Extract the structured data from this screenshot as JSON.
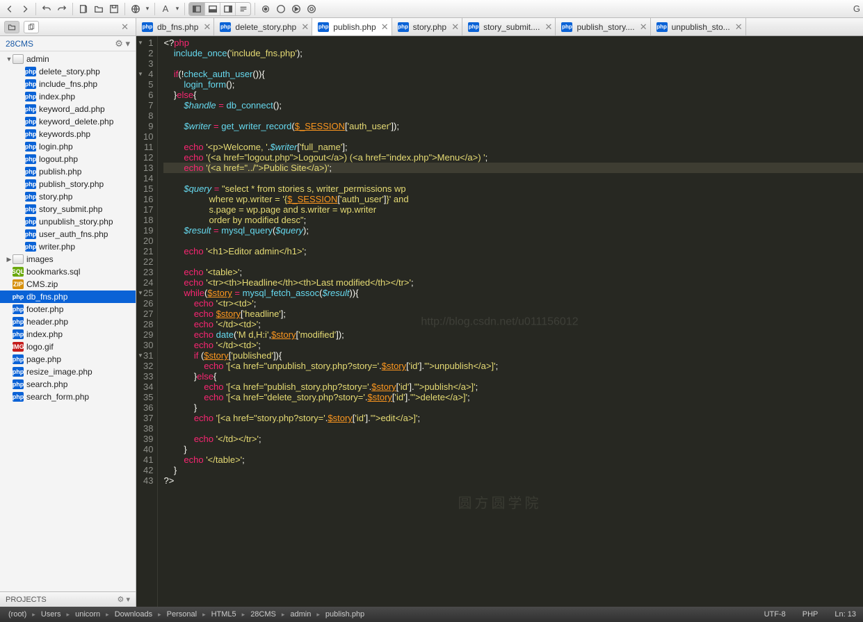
{
  "toolbar": {
    "sync_dropdown": "▾"
  },
  "sidebar": {
    "project_name": "28CMS",
    "footer_label": "PROJECTS",
    "tree": [
      {
        "name": "admin",
        "type": "folder",
        "depth": 0,
        "expanded": true
      },
      {
        "name": "delete_story.php",
        "type": "php",
        "depth": 1
      },
      {
        "name": "include_fns.php",
        "type": "php",
        "depth": 1
      },
      {
        "name": "index.php",
        "type": "php",
        "depth": 1
      },
      {
        "name": "keyword_add.php",
        "type": "php",
        "depth": 1
      },
      {
        "name": "keyword_delete.php",
        "type": "php",
        "depth": 1
      },
      {
        "name": "keywords.php",
        "type": "php",
        "depth": 1
      },
      {
        "name": "login.php",
        "type": "php",
        "depth": 1
      },
      {
        "name": "logout.php",
        "type": "php",
        "depth": 1
      },
      {
        "name": "publish.php",
        "type": "php",
        "depth": 1
      },
      {
        "name": "publish_story.php",
        "type": "php",
        "depth": 1
      },
      {
        "name": "story.php",
        "type": "php",
        "depth": 1
      },
      {
        "name": "story_submit.php",
        "type": "php",
        "depth": 1
      },
      {
        "name": "unpublish_story.php",
        "type": "php",
        "depth": 1
      },
      {
        "name": "user_auth_fns.php",
        "type": "php",
        "depth": 1
      },
      {
        "name": "writer.php",
        "type": "php",
        "depth": 1
      },
      {
        "name": "images",
        "type": "folder",
        "depth": 0,
        "expanded": false
      },
      {
        "name": "bookmarks.sql",
        "type": "sql",
        "depth": 0
      },
      {
        "name": "CMS.zip",
        "type": "zip",
        "depth": 0
      },
      {
        "name": "db_fns.php",
        "type": "php",
        "depth": 0,
        "selected": true
      },
      {
        "name": "footer.php",
        "type": "php",
        "depth": 0
      },
      {
        "name": "header.php",
        "type": "php",
        "depth": 0
      },
      {
        "name": "index.php",
        "type": "php",
        "depth": 0
      },
      {
        "name": "logo.gif",
        "type": "img",
        "depth": 0
      },
      {
        "name": "page.php",
        "type": "php",
        "depth": 0
      },
      {
        "name": "resize_image.php",
        "type": "php",
        "depth": 0
      },
      {
        "name": "search.php",
        "type": "php",
        "depth": 0
      },
      {
        "name": "search_form.php",
        "type": "php",
        "depth": 0
      }
    ]
  },
  "tabs": [
    {
      "label": "db_fns.php"
    },
    {
      "label": "delete_story.php"
    },
    {
      "label": "publish.php",
      "active": true
    },
    {
      "label": "story.php"
    },
    {
      "label": "story_submit....",
      "truncated": true
    },
    {
      "label": "publish_story....",
      "truncated": true
    },
    {
      "label": "unpublish_sto...",
      "truncated": true
    }
  ],
  "editor": {
    "current_line": 13,
    "fold_markers": [
      1,
      4,
      25,
      31
    ],
    "lines": [
      {
        "n": 1,
        "html": "<span class='c-br'>&lt;?</span><span class='c-kw'>php</span>"
      },
      {
        "n": 2,
        "html": "    <span class='c-fn'>include_once</span><span class='c-br'>(</span><span class='c-str'>'include_fns.php'</span><span class='c-br'>);</span>"
      },
      {
        "n": 3,
        "html": ""
      },
      {
        "n": 4,
        "html": "    <span class='c-kw'>if</span><span class='c-br'>(!</span><span class='c-fn'>check_auth_user</span><span class='c-br'>()){</span>"
      },
      {
        "n": 5,
        "html": "        <span class='c-fn'>login_form</span><span class='c-br'>();</span>"
      },
      {
        "n": 6,
        "html": "    <span class='c-br'>}</span><span class='c-kw'>else</span><span class='c-br'>{</span>"
      },
      {
        "n": 7,
        "html": "        <span class='c-var2'>$handle</span> <span class='c-kw'>=</span> <span class='c-fn'>db_connect</span><span class='c-br'>();</span>"
      },
      {
        "n": 8,
        "html": ""
      },
      {
        "n": 9,
        "html": "        <span class='c-var2'>$writer</span> <span class='c-kw'>=</span> <span class='c-fn'>get_writer_record</span><span class='c-br'>(</span><span class='c-var'>$_SESSION</span><span class='c-br'>[</span><span class='c-str'>'auth_user'</span><span class='c-br'>]);</span>"
      },
      {
        "n": 10,
        "html": ""
      },
      {
        "n": 11,
        "html": "        <span class='c-kw'>echo</span> <span class='c-str'>'&lt;p&gt;Welcome, '</span><span class='c-br'>.</span><span class='c-var2'>$writer</span><span class='c-br'>[</span><span class='c-str'>'full_name'</span><span class='c-br'>];</span>"
      },
      {
        "n": 12,
        "html": "        <span class='c-kw'>echo</span> <span class='c-str'>'(&lt;a href=\"logout.php\"&gt;Logout&lt;/a&gt;) (&lt;a href=\"index.php\"&gt;Menu&lt;/a&gt;) '</span><span class='c-br'>;</span>"
      },
      {
        "n": 13,
        "html": "        <span class='c-kw'>echo</span> <span class='c-str'>'(&lt;a href=\"../\"&gt;Public Site&lt;/a&gt;)'</span><span class='c-br'>;</span>",
        "current": true
      },
      {
        "n": 14,
        "html": ""
      },
      {
        "n": 15,
        "html": "        <span class='c-var2'>$query</span> <span class='c-kw'>=</span> <span class='c-str'>\"select * from stories s, writer_permissions wp</span>"
      },
      {
        "n": 16,
        "html": "<span class='c-str'>                  where wp.writer = '{</span><span class='c-var'>$_SESSION</span><span class='c-br'>[</span><span class='c-str'>'auth_user'</span><span class='c-br'>]</span><span class='c-str'>}' and</span>"
      },
      {
        "n": 17,
        "html": "<span class='c-str'>                  s.page = wp.page and s.writer = wp.writer</span>"
      },
      {
        "n": 18,
        "html": "<span class='c-str'>                  order by modified desc\"</span><span class='c-br'>;</span>"
      },
      {
        "n": 19,
        "html": "        <span class='c-var2'>$result</span> <span class='c-kw'>=</span> <span class='c-fn'>mysql_query</span><span class='c-br'>(</span><span class='c-var2'>$query</span><span class='c-br'>);</span>"
      },
      {
        "n": 20,
        "html": ""
      },
      {
        "n": 21,
        "html": "        <span class='c-kw'>echo</span> <span class='c-str'>'&lt;h1&gt;Editor admin&lt;/h1&gt;'</span><span class='c-br'>;</span>"
      },
      {
        "n": 22,
        "html": ""
      },
      {
        "n": 23,
        "html": "        <span class='c-kw'>echo</span> <span class='c-str'>'&lt;table&gt;'</span><span class='c-br'>;</span>"
      },
      {
        "n": 24,
        "html": "        <span class='c-kw'>echo</span> <span class='c-str'>'&lt;tr&gt;&lt;th&gt;Headline&lt;/th&gt;&lt;th&gt;Last modified&lt;/th&gt;&lt;/tr&gt;'</span><span class='c-br'>;</span>"
      },
      {
        "n": 25,
        "html": "        <span class='c-kw'>while</span><span class='c-br'>(</span><span class='c-var'>$story</span> <span class='c-kw'>=</span> <span class='c-fn'>mysql_fetch_assoc</span><span class='c-br'>(</span><span class='c-var2'>$result</span><span class='c-br'>)){</span>"
      },
      {
        "n": 26,
        "html": "            <span class='c-kw'>echo</span> <span class='c-str'>'&lt;tr&gt;&lt;td&gt;'</span><span class='c-br'>;</span>"
      },
      {
        "n": 27,
        "html": "            <span class='c-kw'>echo</span> <span class='c-var'>$story</span><span class='c-br'>[</span><span class='c-str'>'headline'</span><span class='c-br'>];</span>"
      },
      {
        "n": 28,
        "html": "            <span class='c-kw'>echo</span> <span class='c-str'>'&lt;/td&gt;&lt;td&gt;'</span><span class='c-br'>;</span>"
      },
      {
        "n": 29,
        "html": "            <span class='c-kw'>echo</span> <span class='c-fn'>date</span><span class='c-br'>(</span><span class='c-str'>'M d,H:i'</span><span class='c-br'>,</span><span class='c-var'>$story</span><span class='c-br'>[</span><span class='c-str'>'modified'</span><span class='c-br'>]);</span>"
      },
      {
        "n": 30,
        "html": "            <span class='c-kw'>echo</span> <span class='c-str'>'&lt;/td&gt;&lt;td&gt;'</span><span class='c-br'>;</span>"
      },
      {
        "n": 31,
        "html": "            <span class='c-kw'>if</span> <span class='c-br'>(</span><span class='c-var'>$story</span><span class='c-br'>[</span><span class='c-str'>'published'</span><span class='c-br'>]){</span>"
      },
      {
        "n": 32,
        "html": "                <span class='c-kw'>echo</span> <span class='c-str'>'[&lt;a href=\"unpublish_story.php?story='</span><span class='c-br'>.</span><span class='c-var'>$story</span><span class='c-br'>[</span><span class='c-str'>'id'</span><span class='c-br'>].</span><span class='c-str'>'\"&gt;unpublish&lt;/a&gt;]'</span><span class='c-br'>;</span>"
      },
      {
        "n": 33,
        "html": "            <span class='c-br'>}</span><span class='c-kw'>else</span><span class='c-br'>{</span>"
      },
      {
        "n": 34,
        "html": "                <span class='c-kw'>echo</span> <span class='c-str'>'[&lt;a href=\"publish_story.php?story='</span><span class='c-br'>.</span><span class='c-var'>$story</span><span class='c-br'>[</span><span class='c-str'>'id'</span><span class='c-br'>].</span><span class='c-str'>'\"&gt;publish&lt;/a&gt;]'</span><span class='c-br'>;</span>"
      },
      {
        "n": 35,
        "html": "                <span class='c-kw'>echo</span> <span class='c-str'>'[&lt;a href=\"delete_story.php?story='</span><span class='c-br'>.</span><span class='c-var'>$story</span><span class='c-br'>[</span><span class='c-str'>'id'</span><span class='c-br'>].</span><span class='c-str'>'\"&gt;delete&lt;/a&gt;]'</span><span class='c-br'>;</span>"
      },
      {
        "n": 36,
        "html": "            <span class='c-br'>}</span>"
      },
      {
        "n": 37,
        "html": "            <span class='c-kw'>echo</span> <span class='c-str'>'[&lt;a href=\"story.php?story='</span><span class='c-br'>.</span><span class='c-var'>$story</span><span class='c-br'>[</span><span class='c-str'>'id'</span><span class='c-br'>].</span><span class='c-str'>'\"&gt;edit&lt;/a&gt;]'</span><span class='c-br'>;</span>"
      },
      {
        "n": 38,
        "html": ""
      },
      {
        "n": 39,
        "html": "            <span class='c-kw'>echo</span> <span class='c-str'>'&lt;/td&gt;&lt;/tr&gt;'</span><span class='c-br'>;</span>"
      },
      {
        "n": 40,
        "html": "        <span class='c-br'>}</span>"
      },
      {
        "n": 41,
        "html": "        <span class='c-kw'>echo</span> <span class='c-str'>'&lt;/table&gt;'</span><span class='c-br'>;</span>"
      },
      {
        "n": 42,
        "html": "    <span class='c-br'>}</span>"
      },
      {
        "n": 43,
        "html": "<span class='c-br'>?&gt;</span>"
      }
    ]
  },
  "statusbar": {
    "breadcrumbs": [
      "(root)",
      "Users",
      "unicorn",
      "Downloads",
      "Personal",
      "HTML5",
      "28CMS",
      "admin",
      "publish.php"
    ],
    "encoding": "UTF-8",
    "language": "PHP",
    "position": "Ln: 13"
  },
  "watermarks": {
    "url": "http://blog.csdn.net/u011156012",
    "brand": "圆方圆学院"
  }
}
